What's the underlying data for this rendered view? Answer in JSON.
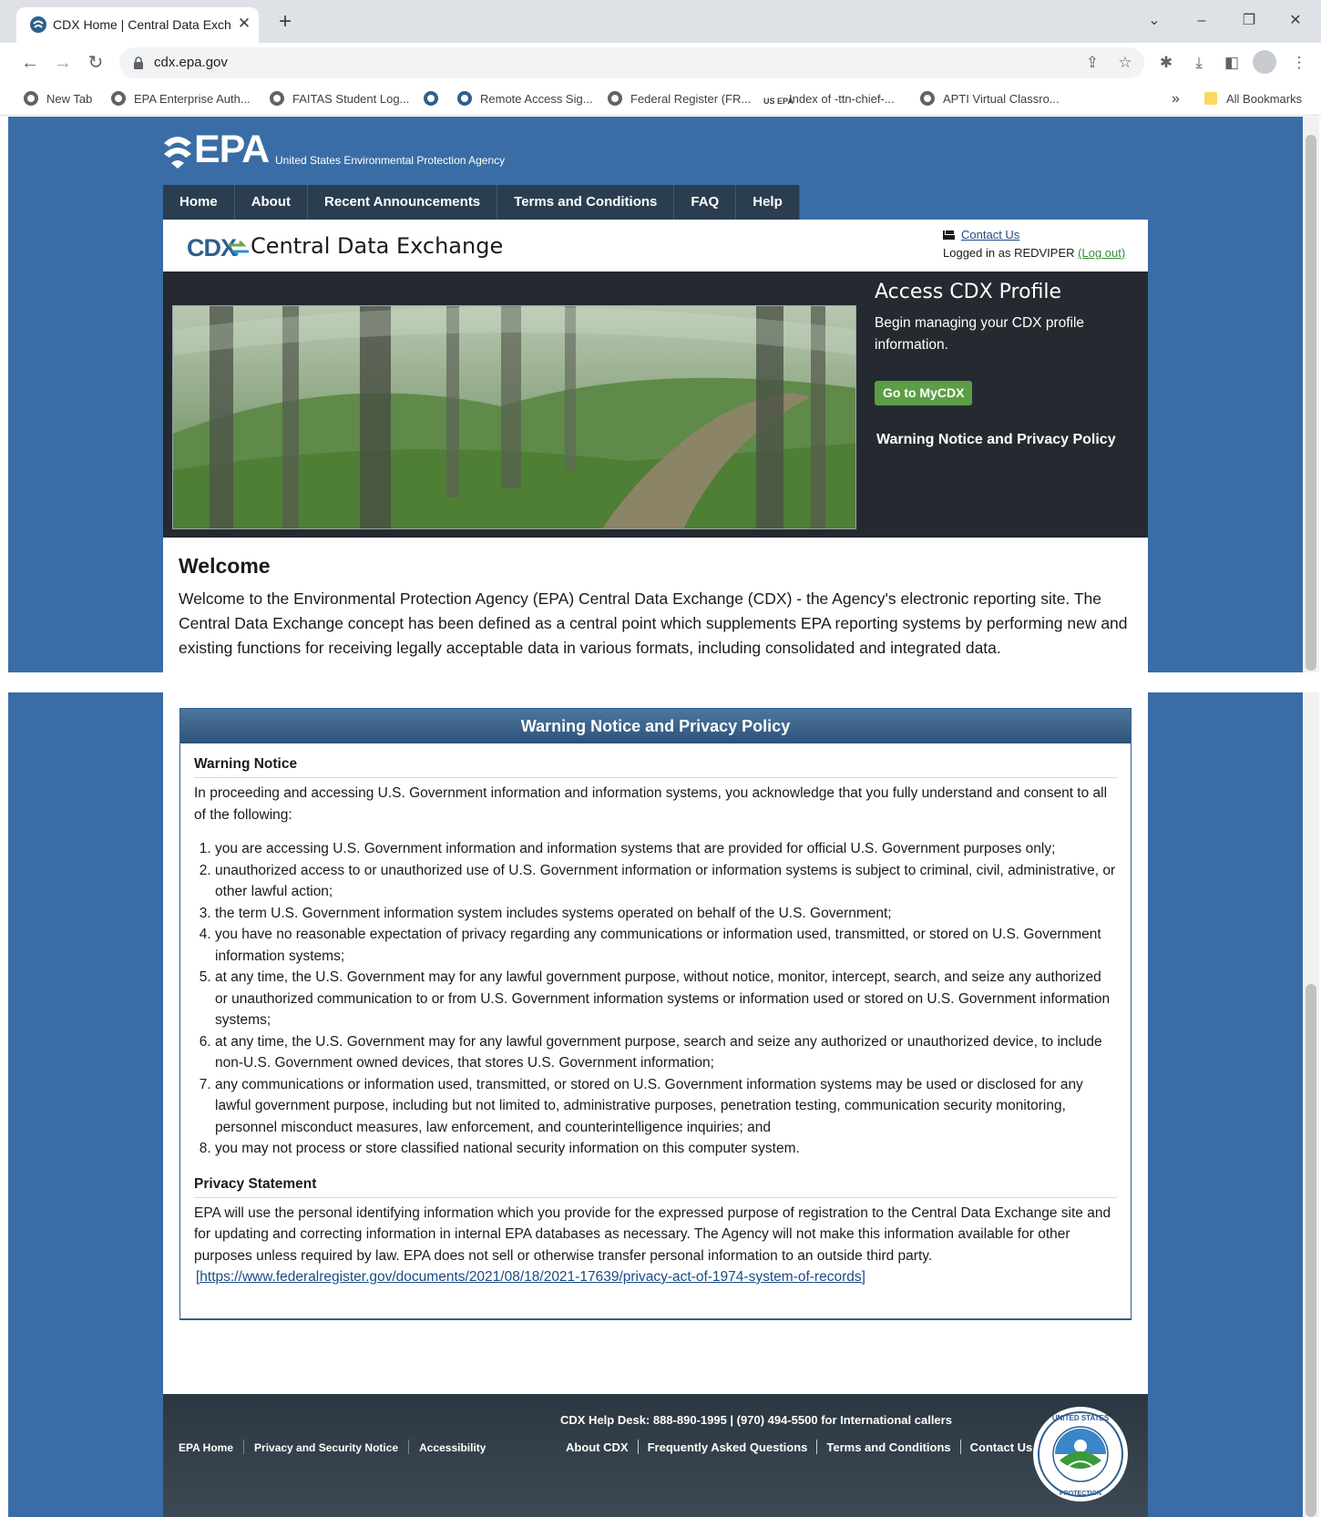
{
  "browser": {
    "tab_title": "CDX Home | Central Data Exchan",
    "url": "cdx.epa.gov",
    "bookmarks": [
      "New Tab",
      "EPA Enterprise Auth...",
      "FAITAS Student Log...",
      "Remote Access Sig...",
      "Federal Register (FR...",
      "Index of -ttn-chief-...",
      "APTI Virtual Classro..."
    ],
    "bookmarks_overflow": "»",
    "all_bookmarks": "All Bookmarks",
    "us_epa_mark": "US EPA"
  },
  "site": {
    "logo_text": "EPA",
    "agency_name": "United States Environmental Protection Agency",
    "nav": [
      "Home",
      "About",
      "Recent Announcements",
      "Terms and Conditions",
      "FAQ",
      "Help"
    ],
    "cdx_mark": "CDX",
    "cdx_title": "Central Data Exchange",
    "contact_us": "Contact Us",
    "logged_in_prefix": "Logged in as REDVIPER",
    "logout": "(Log out)"
  },
  "hero": {
    "access_title": "Access CDX Profile",
    "access_text": "Begin managing your CDX profile information.",
    "mycdx_button": "Go to MyCDX",
    "warning_link": "Warning Notice and Privacy Policy"
  },
  "welcome": {
    "title": "Welcome",
    "text": "Welcome to the Environmental Protection Agency (EPA) Central Data Exchange (CDX) - the Agency's electronic reporting site. The Central Data Exchange concept has been defined as a central point which supplements EPA reporting systems by performing new and existing functions for receiving legally acceptable data in various formats, including consolidated and integrated data."
  },
  "policy": {
    "header": "Warning Notice and Privacy Policy",
    "warning_title": "Warning Notice",
    "warning_intro": "In proceeding and accessing U.S. Government information and information systems, you acknowledge that you fully understand and consent to all of the following:",
    "items": [
      "you are accessing U.S. Government information and information systems that are provided for official U.S. Government purposes only;",
      "unauthorized access to or unauthorized use of U.S. Government information or information systems is subject to criminal, civil, administrative, or other lawful action;",
      "the term U.S. Government information system includes systems operated on behalf of the U.S. Government;",
      "you have no reasonable expectation of privacy regarding any communications or information used, transmitted, or stored on U.S. Government information systems;",
      "at any time, the U.S. Government may for any lawful government purpose, without notice, monitor, intercept, search, and seize any authorized or unauthorized communication to or from U.S. Government information systems or information used or stored on U.S. Government information systems;",
      "at any time, the U.S. Government may for any lawful government purpose, search and seize any authorized or unauthorized device, to include non-U.S. Government owned devices, that stores U.S. Government information;",
      "any communications or information used, transmitted, or stored on U.S. Government information systems may be used or disclosed for any lawful government purpose, including but not limited to, administrative purposes, penetration testing, communication security monitoring, personnel misconduct measures, law enforcement, and counterintelligence inquiries; and",
      "you may not process or store classified national security information on this computer system."
    ],
    "privacy_title": "Privacy Statement",
    "privacy_text": "EPA will use the personal identifying information which you provide for the expressed purpose of registration to the Central Data Exchange site and for updating and correcting information in internal EPA databases as necessary. The Agency will not make this information available for other purposes unless required by law. EPA does not sell or otherwise transfer personal information to an outside third party.",
    "privacy_link": "[https://www.federalregister.gov/documents/2021/08/18/2021-17639/privacy-act-of-1974-system-of-records]"
  },
  "footer": {
    "left_links": [
      "EPA Home",
      "Privacy and Security Notice",
      "Accessibility"
    ],
    "helpdesk": "CDX Help Desk: 888-890-1995 | (970) 494-5500 for International callers",
    "right_links": [
      "About CDX",
      "Frequently Asked Questions",
      "Terms and Conditions",
      "Contact Us"
    ],
    "seal_text": "UNITED STATES ENVIRONMENTAL PROTECTION AGENCY"
  },
  "colors": {
    "page_blue": "#3a6da5",
    "nav_dark": "#2b3e4f",
    "hero_dark": "#242a30",
    "button_green": "#5b9e45",
    "link_blue": "#1a4c85"
  }
}
